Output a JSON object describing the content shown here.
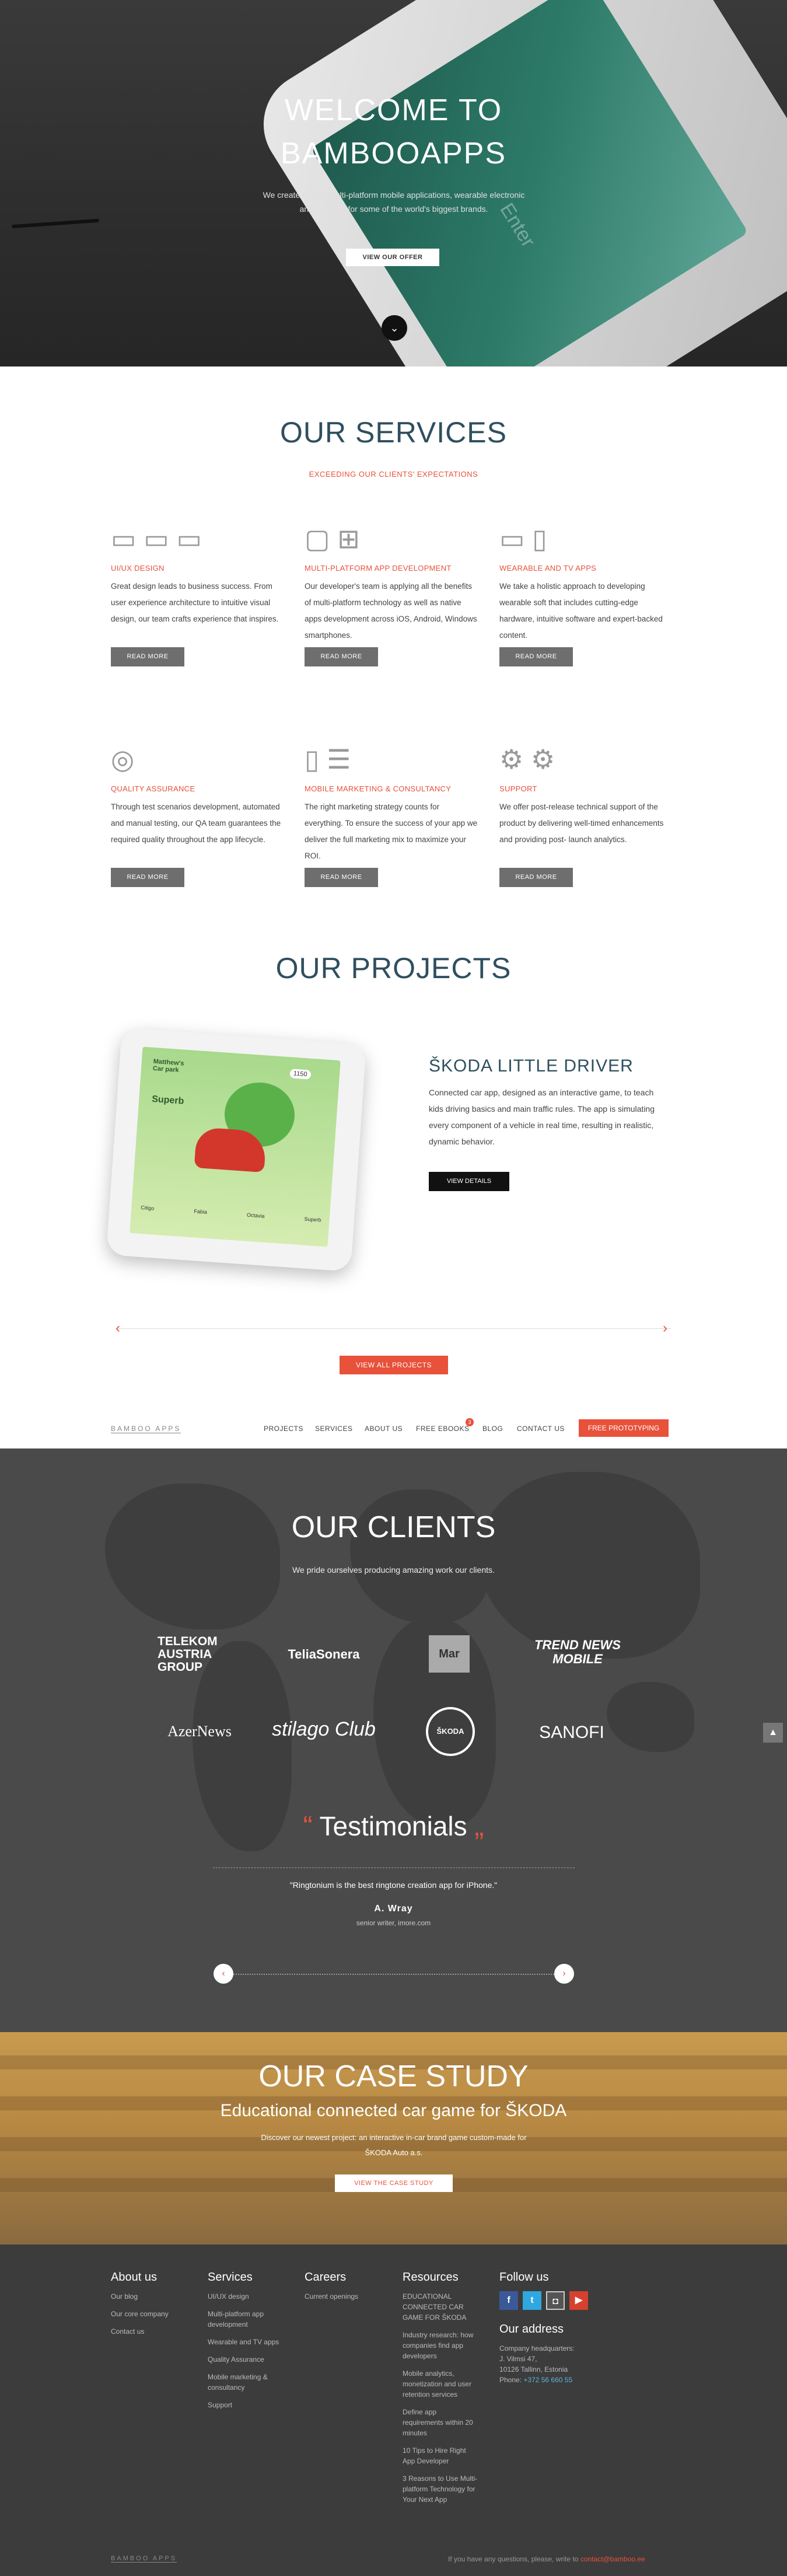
{
  "hero": {
    "title_line1": "WELCOME TO",
    "title_line2": "BAMBOOAPPS",
    "subtitle": "We create native, multi-platform mobile applications, wearable electronic and TV apps for some of the world's biggest brands.",
    "cta": "VIEW OUR OFFER",
    "phone_text": "Enter"
  },
  "services": {
    "title": "OUR SERVICES",
    "subtitle": "EXCEEDING OUR CLIENTS' EXPECTATIONS",
    "read_more": "READ MORE",
    "items": [
      {
        "title": "UI/UX DESIGN",
        "text": "Great design leads to business success. From user experience architecture to intuitive visual design, our team crafts experience that inspires.",
        "icon": "wireframe-icon"
      },
      {
        "title": "MULTI-PLATFORM APP DEVELOPMENT",
        "text": "Our developer's team is applying all the benefits of multi-platform technology as well as native apps development across iOS, Android, Windows smartphones.",
        "icon": "platforms-icon"
      },
      {
        "title": "WEARABLE AND TV APPS",
        "text": "We take a holistic approach to developing wearable soft that includes cutting-edge hardware, intuitive software and expert-backed content.",
        "icon": "tv-watch-icon"
      },
      {
        "title": "QUALITY ASSURANCE",
        "text": "Through test scenarios development, automated and manual testing, our QA team guarantees the required quality throughout the app lifecycle.",
        "icon": "bulb-icon"
      },
      {
        "title": "MOBILE MARKETING & CONSULTANCY",
        "text": "The right marketing strategy counts for everything. To ensure the success of your app we deliver the full marketing mix to maximize your ROI.",
        "icon": "chart-doc-icon"
      },
      {
        "title": "SUPPORT",
        "text": "We offer post-release technical support of the product by delivering well-timed enhancements and providing post- launch analytics.",
        "icon": "gears-icon"
      }
    ]
  },
  "projects": {
    "title": "OUR PROJECTS",
    "project_title": "ŠKODA LITTLE DRIVER",
    "project_desc": "Connected car app, designed as an interactive game, to teach kids driving basics and main traffic rules. The app is simulating every component of a vehicle in real time, resulting in realistic, dynamic behavior.",
    "details": "VIEW DETAILS",
    "view_all": "VIEW ALL PROJECTS",
    "arrow_prev": "‹",
    "arrow_next": "›",
    "screen": {
      "greeting": "Matthew's Car park",
      "score": "1150",
      "level": "Superb",
      "cars": [
        "Citigo",
        "Fabia",
        "Octavia",
        "Superb"
      ]
    }
  },
  "nav": {
    "logo": "BAMBOO APPS",
    "items": [
      "PROJECTS",
      "SERVICES",
      "ABOUT US",
      "FREE EBOOKS",
      "BLOG",
      "CONTACT US"
    ],
    "badge": "3",
    "cta": "FREE PROTOTYPING"
  },
  "clients": {
    "title": "OUR CLIENTS",
    "subtitle": "We pride ourselves producing amazing work our clients.",
    "logos": [
      "TELEKOM AUSTRIA GROUP",
      "TeliaSonera",
      "Mar",
      "TREND NEWS MOBILE",
      "AzerNews",
      "stilago Club",
      "ŠKODA",
      "SANOFI"
    ],
    "up": "▲"
  },
  "testimonials": {
    "title": "Testimonials",
    "quote": "\"Ringtonium is the best ringtone creation app for iPhone.\"",
    "author": "A. Wray",
    "role": "senior writer, imore.com",
    "prev": "‹",
    "next": "›"
  },
  "case_study": {
    "title": "OUR CASE STUDY",
    "subtitle": "Educational connected car game for ŠKODA",
    "text": "Discover our newest project: an interactive in-car brand game custom-made for ŠKODA Auto a.s.",
    "cta": "VIEW THE CASE STUDY"
  },
  "footer": {
    "about": {
      "title": "About us",
      "links": [
        "Our blog",
        "Our core company",
        "Contact us"
      ]
    },
    "services": {
      "title": "Services",
      "links": [
        "UI/UX design",
        "Multi-platform app development",
        "Wearable and TV apps",
        "Quality Assurance",
        "Mobile marketing & consultancy",
        "Support"
      ]
    },
    "careers": {
      "title": "Careers",
      "links": [
        "Current openings"
      ]
    },
    "resources": {
      "title": "Resources",
      "links": [
        "EDUCATIONAL CONNECTED CAR GAME FOR ŠKODA",
        "Industry research: how companies find app developers",
        "Mobile analytics, monetization and user retention services",
        "Define app requirements within 20 minutes",
        "10 Tips to Hire Right App Developer",
        "3 Reasons to Use Multi- platform Technology for Your Next App"
      ]
    },
    "follow": {
      "title": "Follow us"
    },
    "address": {
      "title": "Our address",
      "line1": "Company headquarters:",
      "line2": "J. Vilmsi 47,",
      "line3": "10126 Tallinn, Estonia",
      "phone_label": "Phone:",
      "phone": "+372 56 660 55"
    },
    "logo": "BAMBOO APPS",
    "contact_text": "If you have any questions, please, write to",
    "contact_mail": "contact@bamboo.ee"
  }
}
